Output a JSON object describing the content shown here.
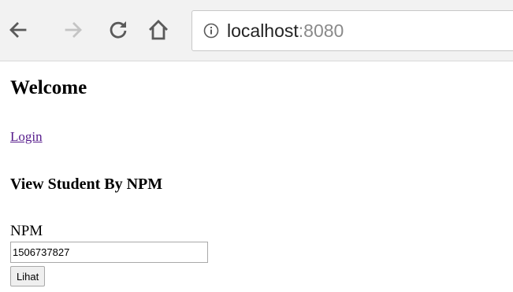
{
  "browser": {
    "url_host": "localhost",
    "url_port": ":8080",
    "icons": {
      "back": "arrow-left-icon",
      "forward": "arrow-right-icon",
      "reload": "reload-icon",
      "home": "home-icon",
      "info": "info-icon"
    }
  },
  "page": {
    "title": "Welcome",
    "login_link": "Login",
    "section_title": "View Student By NPM",
    "form": {
      "npm_label": "NPM",
      "npm_value": "1506737827",
      "submit_label": "Lihat"
    }
  },
  "colors": {
    "toolbar_bg": "#f2f2f2",
    "link_visited": "#551a8b",
    "url_port": "#8a8a8a"
  }
}
